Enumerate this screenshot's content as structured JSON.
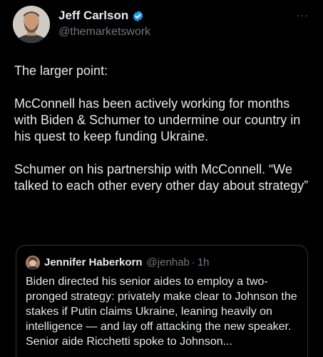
{
  "author": {
    "display_name": "Jeff Carlson",
    "handle": "@themarketswork",
    "verified": true
  },
  "more_label": "···",
  "tweet_text": "The larger point:\n\nMcConnell has been actively working for months with Biden & Schumer to undermine our country in his quest to keep funding Ukraine.\n\nSchumer on his partnership with McConnell. “We talked to each other every other day about strategy”",
  "quoted_tweet": {
    "display_name": "Jennifer Haberkorn",
    "handle": "@jenhab",
    "separator": "·",
    "time": "1h",
    "text": "Biden directed his senior aides to employ a two-pronged strategy: privately make clear to Johnson the stakes if Putin claims Ukraine, leaning heavily on intelligence — and lay off attacking the new speaker. Senior aide Ricchetti spoke to Johnson..."
  },
  "colors": {
    "background": "#000000",
    "text": "#e7e9ea",
    "secondary_text": "#71767b",
    "verified_badge": "#1d9bf0",
    "border": "#2f3336"
  }
}
